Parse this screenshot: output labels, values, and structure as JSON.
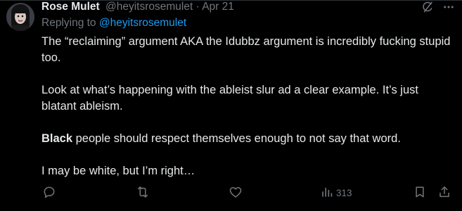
{
  "tweet": {
    "display_name": "Rose Mulet",
    "handle": "@heyitsrosemulet",
    "separator": "·",
    "date": "Apr 21",
    "replying_to_label": "Replying to ",
    "replying_to_handle": "@heyitsrosemulet",
    "paragraphs": {
      "p1": "The “reclaiming” argument AKA the Idubbz argument is incredibly fucking stupid too.",
      "p2": "Look at what’s happening with the ableist slur ad a clear example. It’s just blatant ableism.",
      "p3_bold": "Black",
      "p3_rest": " people should respect themselves enough to not say that word.",
      "p4": "I may be white, but I’m right…"
    }
  },
  "actions": {
    "views_count": "313"
  },
  "colors": {
    "background": "#000000",
    "text_primary": "#e7e9ea",
    "text_secondary": "#71767b",
    "accent": "#1d9bf0",
    "divider": "#2f3336"
  },
  "icons": {
    "grok": "grok-icon",
    "more": "more-icon",
    "reply": "reply-icon",
    "retweet": "retweet-icon",
    "like": "like-icon",
    "views": "views-icon",
    "bookmark": "bookmark-icon",
    "share": "share-icon"
  }
}
